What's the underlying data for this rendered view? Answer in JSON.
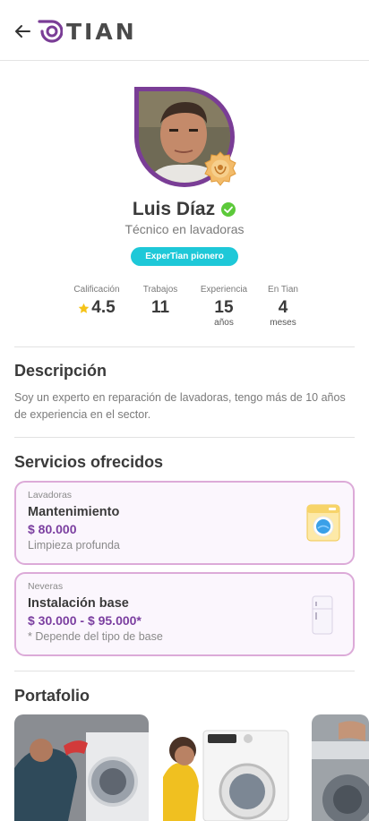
{
  "header": {
    "brand": "TIAN"
  },
  "profile": {
    "name": "Luis Díaz",
    "role": "Técnico en lavadoras",
    "tag": "ExperTian pionero"
  },
  "stats": [
    {
      "label": "Calificación",
      "value": "4.5",
      "unit": ""
    },
    {
      "label": "Trabajos",
      "value": "11",
      "unit": ""
    },
    {
      "label": "Experiencia",
      "value": "15",
      "unit": "años"
    },
    {
      "label": "En Tian",
      "value": "4",
      "unit": "meses"
    }
  ],
  "description": {
    "title": "Descripción",
    "text": "Soy un experto en reparación de lavadoras, tengo más de 10 años de experiencia en el sector."
  },
  "services": {
    "title": "Servicios ofrecidos",
    "items": [
      {
        "category": "Lavadoras",
        "name": "Mantenimiento",
        "price": "$ 80.000",
        "note": "Limpieza profunda",
        "icon": "washing-machine-icon"
      },
      {
        "category": "Neveras",
        "name": "Instalación base",
        "price": "$ 30.000 - $ 95.000*",
        "note": "* Depende del tipo de base",
        "icon": "fridge-icon"
      }
    ]
  },
  "portfolio": {
    "title": "Portafolio"
  },
  "colors": {
    "brand_purple": "#7a3d96",
    "accent_cyan": "#1ec8d8",
    "verified_green": "#5cc93a",
    "card_border": "#dcaad8"
  }
}
